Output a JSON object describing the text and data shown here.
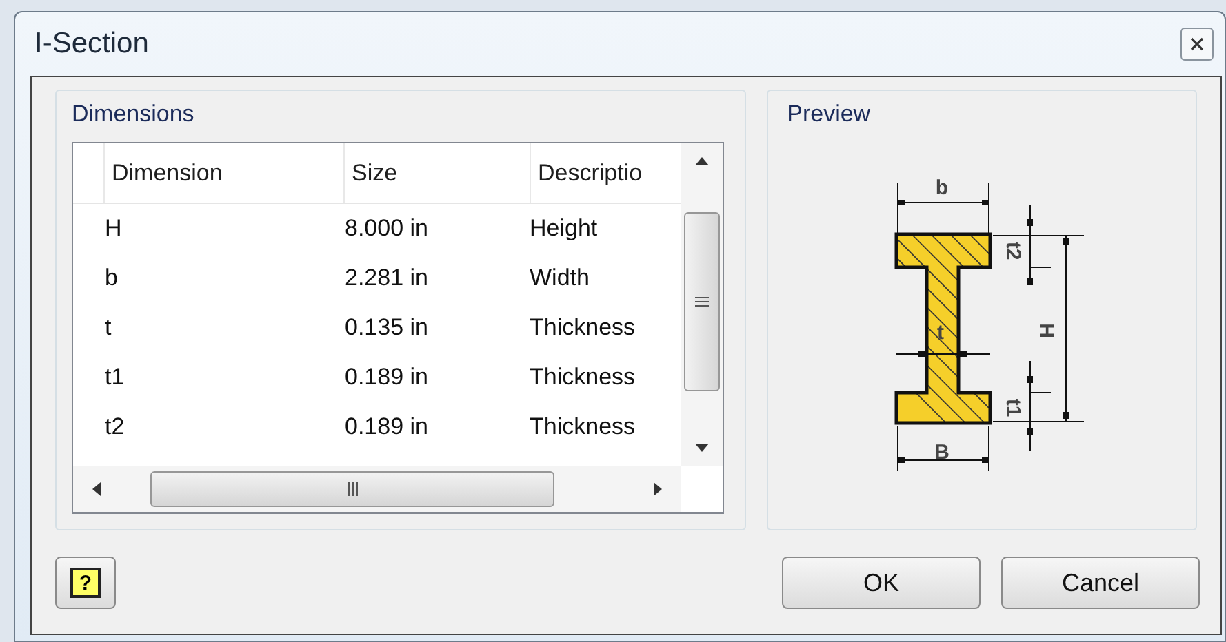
{
  "window": {
    "title": "I-Section"
  },
  "dimensions": {
    "title": "Dimensions",
    "columns": [
      "Dimension",
      "Size",
      "Descriptio"
    ],
    "rows": [
      {
        "dimension": "H",
        "size": "8.000 in",
        "description": "Height"
      },
      {
        "dimension": "b",
        "size": "2.281 in",
        "description": "Width"
      },
      {
        "dimension": "t",
        "size": "0.135 in",
        "description": "Thickness"
      },
      {
        "dimension": "t1",
        "size": "0.189 in",
        "description": "Thickness"
      },
      {
        "dimension": "t2",
        "size": "0.189 in",
        "description": "Thickness"
      }
    ]
  },
  "preview": {
    "title": "Preview",
    "labels": [
      "b",
      "t2",
      "H",
      "t",
      "t1",
      "B"
    ]
  },
  "help_button": {
    "label": "?"
  },
  "buttons": [
    "OK",
    "Cancel"
  ]
}
